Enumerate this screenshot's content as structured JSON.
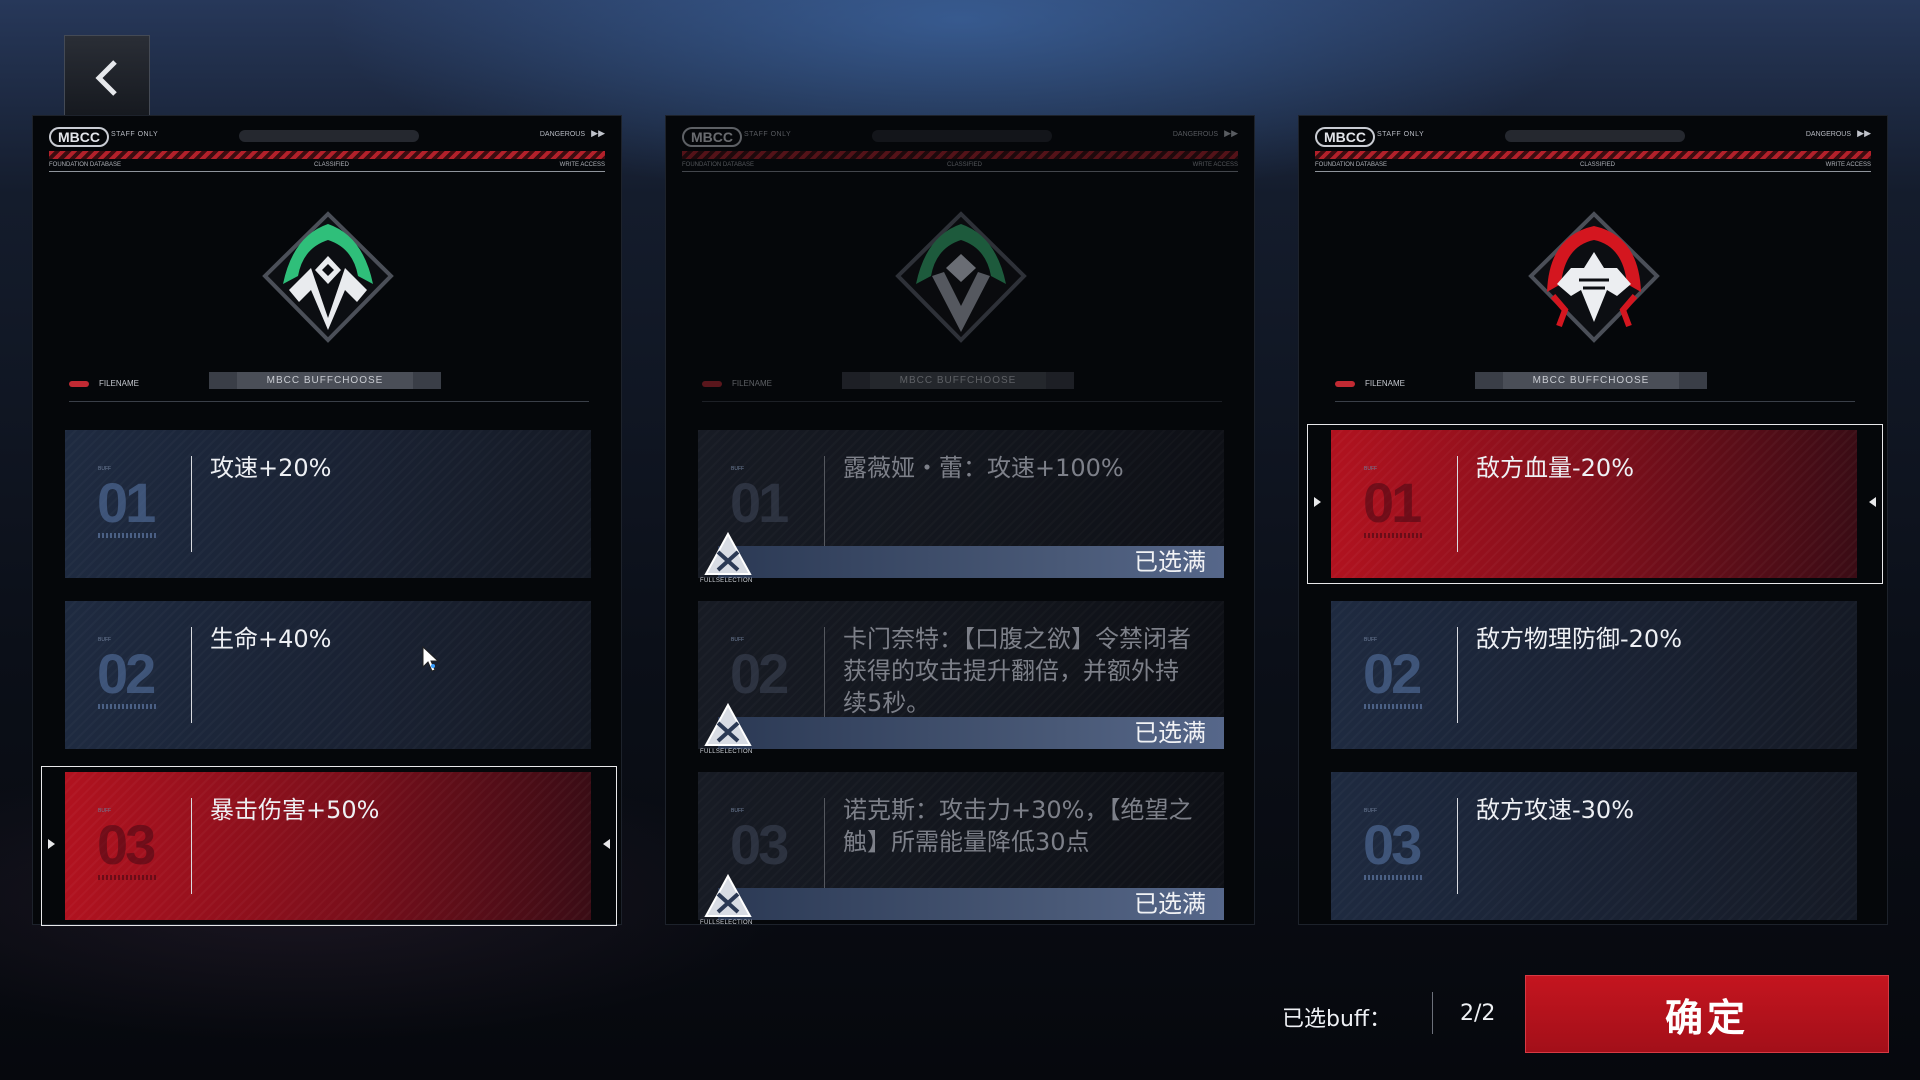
{
  "header": {
    "back_icon": "chevron-left-icon"
  },
  "panels": [
    {
      "badge": "MBCC",
      "staff_only": "STAFF ONLY",
      "dangerous": "DANGEROUS",
      "sub_left": "FOUNDATION DATABASE",
      "sub_center": "CLASSIFIED",
      "sub_right": "WRITE ACCESS",
      "emblem_icon": "green-crest-emblem-icon",
      "file_label": "FILENAME",
      "buff_bar": "MBCC BUFFCHOOSE",
      "options": [
        {
          "num": "01",
          "text": "攻速+20%"
        },
        {
          "num": "02",
          "text": "生命+40%"
        },
        {
          "num": "03",
          "text": "暴击伤害+50%"
        }
      ]
    },
    {
      "badge": "MBCC",
      "staff_only": "STAFF ONLY",
      "dangerous": "DANGEROUS",
      "sub_left": "FOUNDATION DATABASE",
      "sub_center": "CLASSIFIED",
      "sub_right": "WRITE ACCESS",
      "emblem_icon": "dark-crest-emblem-icon",
      "file_label": "FILENAME",
      "buff_bar": "MBCC BUFFCHOOSE",
      "full_label": "已选满",
      "full_caption": "FULLSELECTION",
      "options": [
        {
          "num": "01",
          "text": "露薇娅・蕾：攻速+100%"
        },
        {
          "num": "02",
          "text": "卡门奈特：【口腹之欲】令禁闭者获得的攻击提升翻倍，并额外持续5秒。"
        },
        {
          "num": "03",
          "text": "诺克斯：攻击力+30%，【绝望之触】所需能量降低30点"
        }
      ]
    },
    {
      "badge": "MBCC",
      "staff_only": "STAFF ONLY",
      "dangerous": "DANGEROUS",
      "sub_left": "FOUNDATION DATABASE",
      "sub_center": "CLASSIFIED",
      "sub_right": "WRITE ACCESS",
      "emblem_icon": "red-crest-emblem-icon",
      "file_label": "FILENAME",
      "buff_bar": "MBCC BUFFCHOOSE",
      "options": [
        {
          "num": "01",
          "text": "敌方血量-20%"
        },
        {
          "num": "02",
          "text": "敌方物理防御-20%"
        },
        {
          "num": "03",
          "text": "敌方攻速-30%"
        }
      ]
    }
  ],
  "footer": {
    "selected_label": "已选buff：",
    "selected_count": "2/2",
    "confirm_label": "确定"
  },
  "colors": {
    "accent_red": "#c4151f",
    "emblem_green": "#3fd08a",
    "emblem_red": "#d4161f"
  }
}
